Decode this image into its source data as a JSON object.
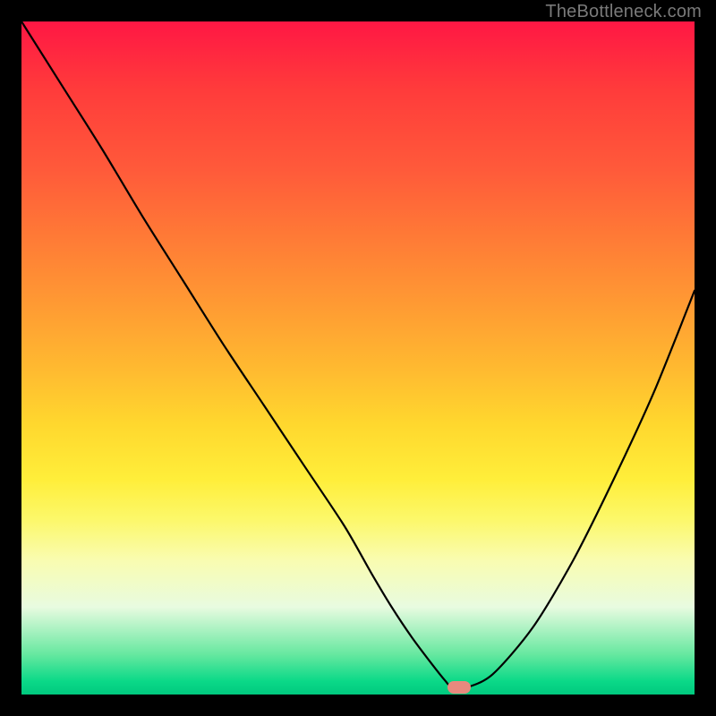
{
  "watermark": "TheBottleneck.com",
  "chart_data": {
    "type": "line",
    "title": "",
    "xlabel": "",
    "ylabel": "",
    "xlim": [
      0,
      100
    ],
    "ylim": [
      0,
      100
    ],
    "grid": false,
    "legend": false,
    "series": [
      {
        "name": "bottleneck-curve",
        "x": [
          0,
          6,
          12,
          18,
          24,
          30,
          36,
          42,
          48,
          52,
          55,
          58,
          61,
          63,
          64,
          66,
          70,
          76,
          82,
          88,
          94,
          100
        ],
        "y": [
          100,
          90.5,
          81,
          71,
          61.5,
          52,
          43,
          34,
          25,
          18,
          13,
          8.5,
          4.5,
          2,
          1,
          1,
          3,
          10,
          20,
          32,
          45,
          60
        ]
      }
    ],
    "marker": {
      "x": 65,
      "y": 1,
      "color": "#e8897e"
    },
    "background_gradient": {
      "top": "#ff1744",
      "mid": "#ffd82e",
      "bottom": "#00c97e"
    }
  }
}
